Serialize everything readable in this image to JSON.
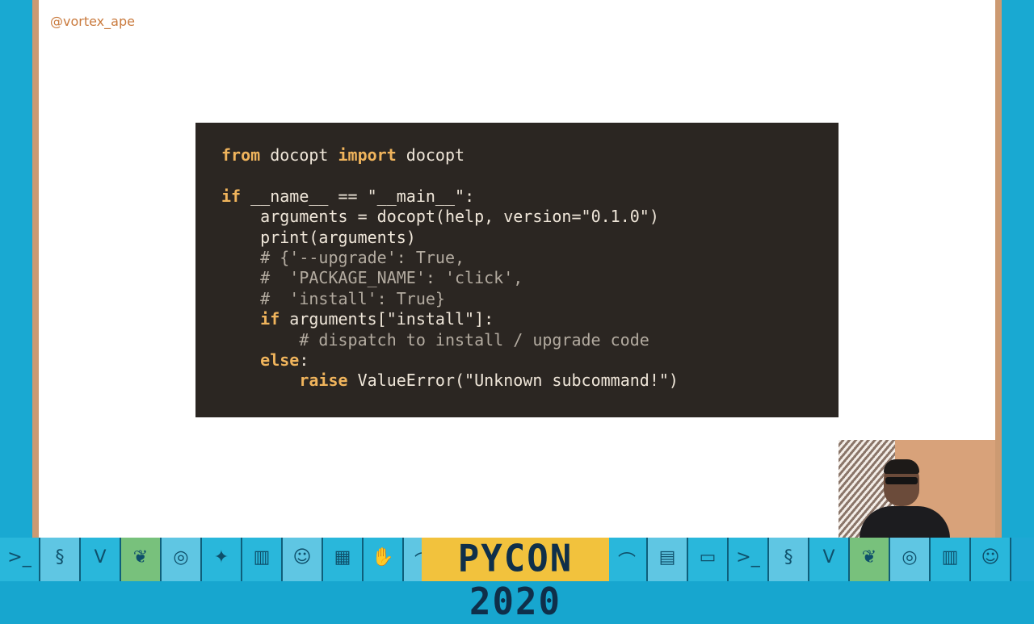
{
  "slide": {
    "handle": "@vortex_ape"
  },
  "code": {
    "lines": [
      [
        {
          "t": "from",
          "c": "kw"
        },
        {
          "t": " docopt ",
          "c": ""
        },
        {
          "t": "import",
          "c": "kw"
        },
        {
          "t": " docopt",
          "c": ""
        }
      ],
      [],
      [
        {
          "t": "if",
          "c": "kw"
        },
        {
          "t": " __name__ == ",
          "c": ""
        },
        {
          "t": "\"__main__\"",
          "c": "str"
        },
        {
          "t": ":",
          "c": ""
        }
      ],
      [
        {
          "t": "    arguments = docopt(help, version=",
          "c": ""
        },
        {
          "t": "\"0.1.0\"",
          "c": "str"
        },
        {
          "t": ")",
          "c": ""
        }
      ],
      [
        {
          "t": "    print(arguments)",
          "c": ""
        }
      ],
      [
        {
          "t": "    # {'--upgrade': True,",
          "c": "cm"
        }
      ],
      [
        {
          "t": "    #  'PACKAGE_NAME': 'click',",
          "c": "cm"
        }
      ],
      [
        {
          "t": "    #  'install': True}",
          "c": "cm"
        }
      ],
      [
        {
          "t": "    ",
          "c": ""
        },
        {
          "t": "if",
          "c": "kw"
        },
        {
          "t": " arguments[",
          "c": ""
        },
        {
          "t": "\"install\"",
          "c": "str"
        },
        {
          "t": "]:",
          "c": ""
        }
      ],
      [
        {
          "t": "        # dispatch to install / upgrade code",
          "c": "cm"
        }
      ],
      [
        {
          "t": "    ",
          "c": ""
        },
        {
          "t": "else",
          "c": "kw"
        },
        {
          "t": ":",
          "c": ""
        }
      ],
      [
        {
          "t": "        ",
          "c": ""
        },
        {
          "t": "raise",
          "c": "kw"
        },
        {
          "t": " ValueError(",
          "c": ""
        },
        {
          "t": "\"Unknown subcommand!\"",
          "c": "str"
        },
        {
          "t": ")",
          "c": ""
        }
      ]
    ]
  },
  "footer": {
    "logo_text": "PYCON 2020",
    "left_icons": [
      "terminal-icon",
      "snake-icon",
      "v-icon",
      "leaf-icon",
      "circle-icon",
      "sparkle-icon",
      "bars-icon",
      "robot-icon",
      "chip-icon",
      "hand-icon",
      "bridge-icon"
    ],
    "right_icons": [
      "bridge-icon",
      "stage-icon",
      "window-icon",
      "terminal-icon",
      "snake-icon",
      "v-icon",
      "leaf-icon",
      "circle-icon",
      "bars-icon",
      "robot-icon"
    ]
  },
  "colors": {
    "code_bg": "#2b2622",
    "keyword": "#f0b45c",
    "handle": "#c97a3d",
    "banner_blue": "#1ea8d4",
    "logo_yellow": "#f2c23d"
  }
}
